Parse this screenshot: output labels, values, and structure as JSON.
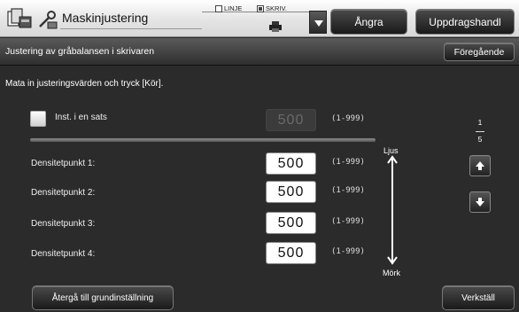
{
  "titlebar": {
    "title": "Maskinjustering",
    "mode_icon": "copy-scan-mode-icon",
    "title_icon": "machine-adjust-icon",
    "checkbox_linje": {
      "label": "LINJE",
      "checked": false
    },
    "checkbox_skriv": {
      "label": "SKRIV.",
      "checked": true
    },
    "printer_icon": "printer-icon",
    "dropdown_icon": "triangle-down-icon",
    "undo_label": "Ångra",
    "jobstatus_label": "Uppdragshandl"
  },
  "subheader": {
    "title": "Justering av gråbalansen i skrivaren",
    "prev_label": "Föregående"
  },
  "main": {
    "instruction": "Mata in justeringsvärden och tryck [Kör].",
    "batch": {
      "label": "Inst. i en sats",
      "value": "500",
      "range": "(1-999)",
      "enabled": false
    },
    "density_points": [
      {
        "label": "Densitetpunkt 1:",
        "value": "500",
        "range": "(1-999)"
      },
      {
        "label": "Densitetpunkt 2:",
        "value": "500",
        "range": "(1-999)"
      },
      {
        "label": "Densitetpunkt 3:",
        "value": "500",
        "range": "(1-999)"
      },
      {
        "label": "Densitetpunkt 4:",
        "value": "500",
        "range": "(1-999)"
      }
    ],
    "scale": {
      "top": "Ljus",
      "bottom": "Mörk"
    },
    "pager": {
      "current": "1",
      "total": "5",
      "up_icon": "arrow-up-icon",
      "down_icon": "arrow-down-icon"
    },
    "reset_label": "Återgå till grundinställning",
    "apply_label": "Verkställ"
  },
  "colors": {
    "background": "#2b2b2b",
    "titlebar": "#e6e6e6",
    "value_box": "#ffffff"
  }
}
